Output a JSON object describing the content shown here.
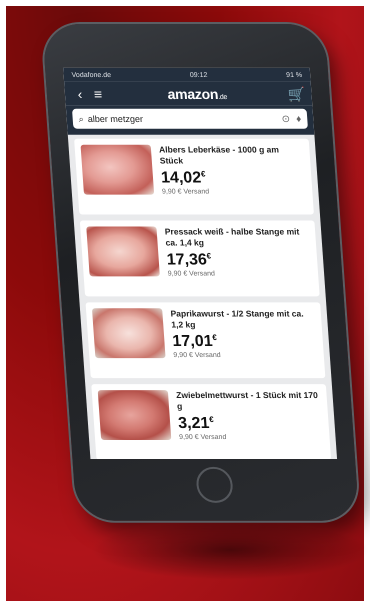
{
  "status": {
    "carrier": "Vodafone.de",
    "time": "09:12",
    "battery": "91 %"
  },
  "header": {
    "logo": "amazon",
    "logo_suffix": ".de"
  },
  "search": {
    "query": "alber metzger"
  },
  "products": [
    {
      "title": "Albers Leberkäse - 1000 g am Stück",
      "price_main": "14,02",
      "currency": "€",
      "shipping": "9,90 € Versand"
    },
    {
      "title": "Pressack weiß - halbe Stange mit ca. 1,4 kg",
      "price_main": "17,36",
      "currency": "€",
      "shipping": "9,90 € Versand"
    },
    {
      "title": "Paprikawurst - 1/2 Stange mit ca. 1,2 kg",
      "price_main": "17,01",
      "currency": "€",
      "shipping": "9,90 € Versand"
    },
    {
      "title": "Zwiebelmettwurst - 1 Stück mit 170 g",
      "price_main": "3,21",
      "currency": "€",
      "shipping": "9,90 € Versand"
    }
  ],
  "colors": {
    "header_bg": "#232f3e",
    "background": "#a6121a"
  }
}
